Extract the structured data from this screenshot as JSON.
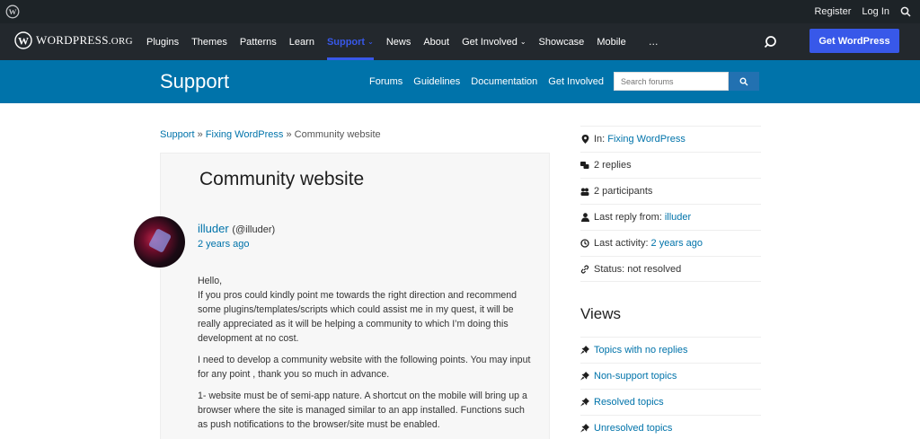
{
  "adminbar": {
    "register": "Register",
    "login": "Log In"
  },
  "globalnav": {
    "logo_main": "WordPress",
    "logo_suffix": ".org",
    "items": [
      "Plugins",
      "Themes",
      "Patterns",
      "Learn",
      "Support",
      "News",
      "About",
      "Get Involved",
      "Showcase",
      "Mobile",
      "…"
    ],
    "active_item": "Support",
    "get_wordpress": "Get WordPress",
    "accent_color": "#3858e9"
  },
  "support_header": {
    "title": "Support",
    "nav": [
      "Forums",
      "Guidelines",
      "Documentation",
      "Get Involved"
    ],
    "search_placeholder": "Search forums",
    "bg_color": "#0073aa"
  },
  "breadcrumb": {
    "items": [
      "Support",
      "Fixing WordPress"
    ],
    "separator": "»",
    "current": "Community website"
  },
  "topic": {
    "title": "Community website",
    "author_name": "illuder",
    "author_handle": "(@illuder)",
    "time_ago": "2 years ago",
    "paragraphs": [
      "Hello,\nIf you pros could kindly point me towards the right direction and recommend some plugins/templates/scripts which could assist me in my quest, it will be really appreciated as it will be helping a community to which I’m doing this development at no cost.",
      "I need to develop a community website with the following points. You may input for any point , thank you so much in advance.",
      "1- website must be of semi-app nature. A shortcut on the mobile will bring up a browser where the site is managed similar to an app installed. Functions such as push notifications to the browser/site must be enabled."
    ]
  },
  "sidebar": {
    "in_label": "In:",
    "in_link": "Fixing WordPress",
    "replies": "2 replies",
    "participants": "2 participants",
    "last_reply_label": "Last reply from:",
    "last_reply_link": "illuder",
    "last_activity_label": "Last activity:",
    "last_activity_link": "2 years ago",
    "status": "Status: not resolved"
  },
  "views": {
    "title": "Views",
    "items": [
      "Topics with no replies",
      "Non-support topics",
      "Resolved topics",
      "Unresolved topics"
    ]
  }
}
